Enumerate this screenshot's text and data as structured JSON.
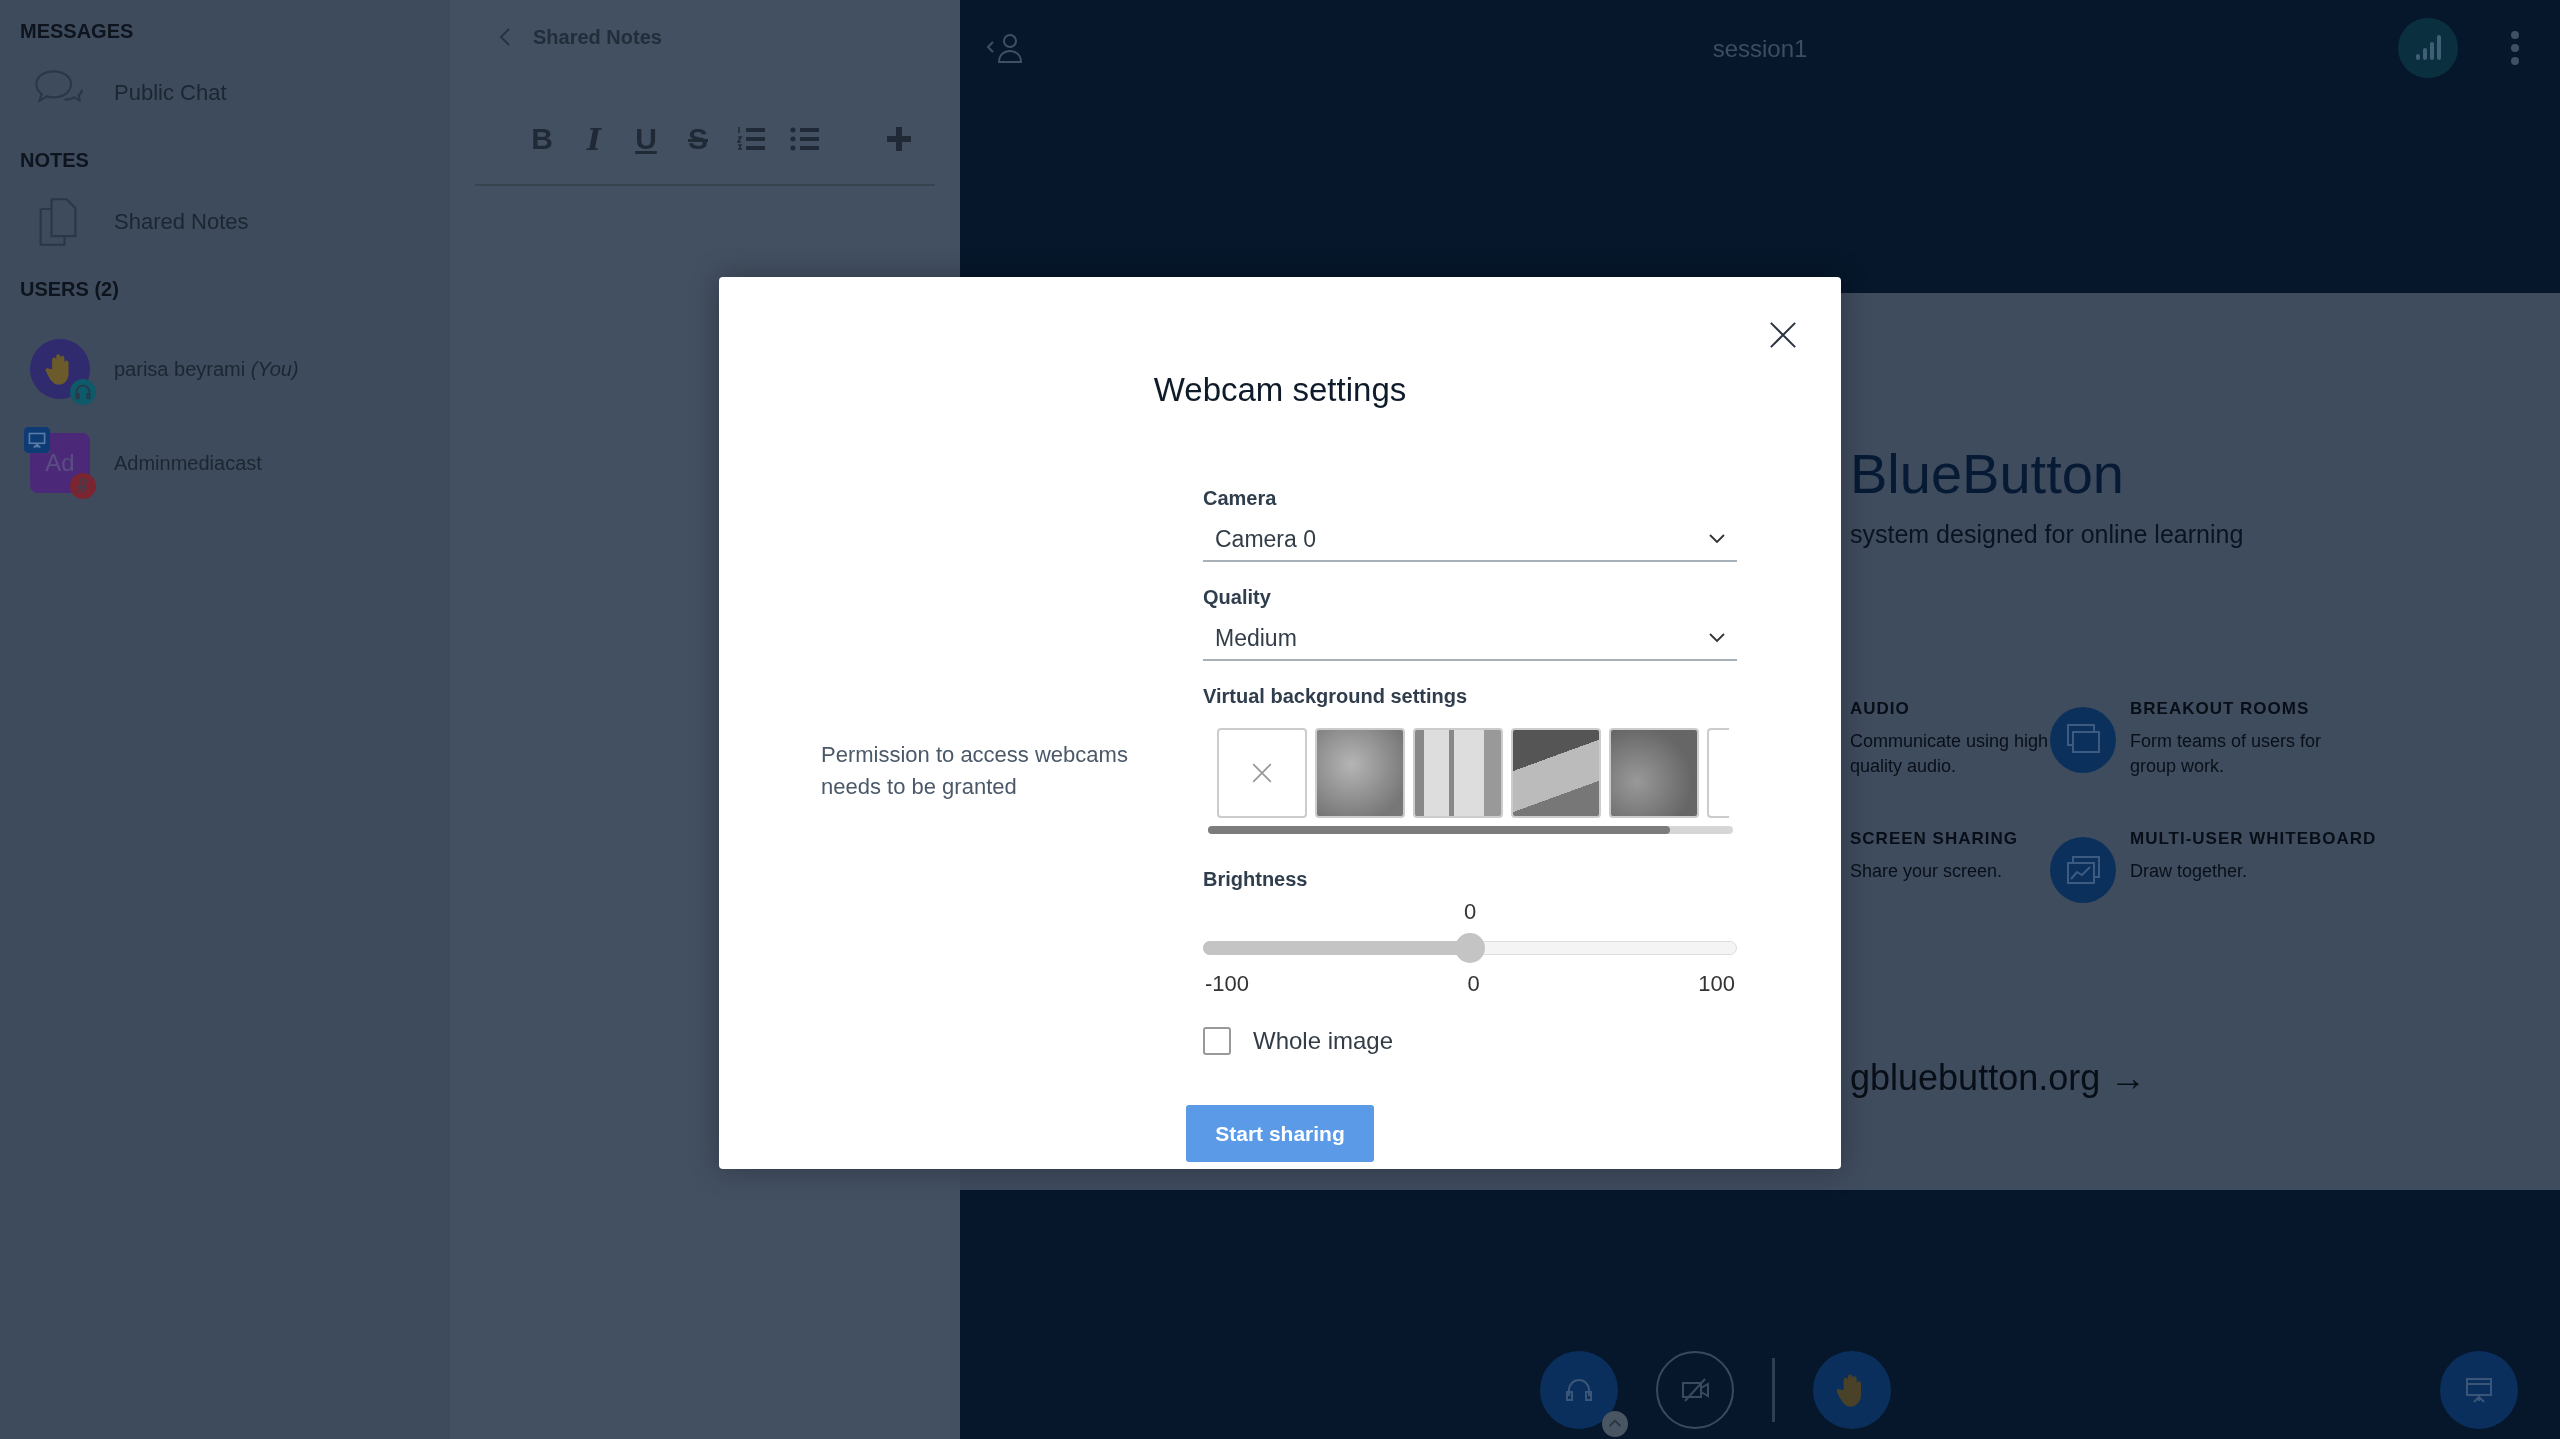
{
  "sidebar": {
    "sections": [
      {
        "title": "MESSAGES",
        "items": [
          {
            "kind": "chat",
            "label": "Public Chat"
          }
        ]
      },
      {
        "title": "NOTES",
        "items": [
          {
            "kind": "notes",
            "label": "Shared Notes"
          }
        ]
      }
    ],
    "users_title": "USERS (2)",
    "users": [
      {
        "name": "parisa beyrami",
        "you_tag": "(You)",
        "moderator": false,
        "hand_raised": true,
        "presenter": false,
        "muted": false
      },
      {
        "name": "Adminmediacast",
        "initials": "Ad",
        "moderator": true,
        "hand_raised": false,
        "presenter": true,
        "muted": true
      }
    ]
  },
  "notes_panel": {
    "title": "Shared Notes",
    "toolbar": [
      {
        "kind": "bold",
        "glyph": "B"
      },
      {
        "kind": "italic",
        "glyph": "I"
      },
      {
        "kind": "underline",
        "glyph": "U"
      },
      {
        "kind": "strike",
        "glyph": "S"
      },
      {
        "kind": "ordered-list"
      },
      {
        "kind": "bullet-list"
      },
      {
        "kind": "add"
      }
    ]
  },
  "top_bar": {
    "title": "session1"
  },
  "presentation": {
    "title": "BlueButton",
    "subtitle": "system designed for online learning",
    "features": [
      {
        "kind": "audio",
        "title": "AUDIO",
        "text": "Communicate using high quality audio."
      },
      {
        "kind": "breakout",
        "title": "BREAKOUT ROOMS",
        "text": "Form teams of users for group work."
      },
      {
        "kind": "screen",
        "title": "SCREEN SHARING",
        "text": "Share your screen."
      },
      {
        "kind": "whiteboard",
        "title": "MULTI-USER WHITEBOARD",
        "text": "Draw together."
      }
    ],
    "link": "gbluebutton.org →"
  },
  "bottom_bar": {
    "audio_joined": true,
    "video_on": false,
    "hand_raised": true
  },
  "modal": {
    "title": "Webcam settings",
    "message": "Permission to access webcams needs to be granted",
    "fields": [
      {
        "label": "Camera",
        "value": "Camera 0"
      },
      {
        "label": "Quality",
        "value": "Medium"
      }
    ],
    "virtual_background": {
      "label": "Virtual background settings",
      "options": [
        {
          "kind": "none"
        },
        {
          "kind": "blur"
        },
        {
          "kind": "room"
        },
        {
          "kind": "office"
        },
        {
          "kind": "texture"
        },
        {
          "kind": "blank"
        }
      ]
    },
    "brightness": {
      "label": "Brightness",
      "value": "0",
      "level": 0.5,
      "min": "-100",
      "mid": "0",
      "max": "100"
    },
    "whole_image": {
      "label": "Whole image",
      "checked": false
    },
    "button": "Start sharing"
  }
}
